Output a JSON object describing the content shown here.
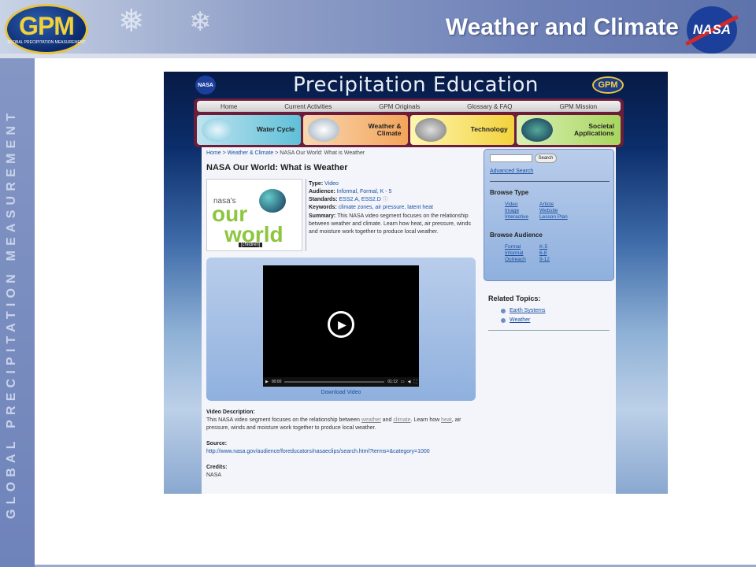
{
  "slide": {
    "title": "Weather and Climate",
    "logo_left": "GPM",
    "logo_left_sub": "GLOBAL PRECIPITATION MEASUREMENT",
    "logo_right": "NASA",
    "vertical_text": "GLOBAL PRECIPITATION MEASUREMENT"
  },
  "site": {
    "title": "Precipitation Education",
    "nasa_badge": "NASA",
    "gpm_badge": "GPM",
    "nav": [
      "Home",
      "Current Activities",
      "GPM Originals",
      "Glossary & FAQ",
      "GPM Mission"
    ],
    "categories": [
      {
        "label": "Water Cycle"
      },
      {
        "label": "Weather & Climate"
      },
      {
        "label": "Technology"
      },
      {
        "label": "Societal Applications"
      }
    ]
  },
  "page": {
    "breadcrumb": {
      "home": "Home",
      "sep1": " > ",
      "section": "Weather & Climate",
      "sep2": " > ",
      "current": "NASA Our World: What is Weather"
    },
    "title": "NASA Our World: What is Weather",
    "thumb": {
      "line1": "nasa's",
      "line2": "our",
      "line3": "world",
      "tag": "[children]"
    },
    "meta": {
      "type_label": "Type:",
      "type_value": "Video",
      "audience_label": "Audience:",
      "audience_value": "Informal, Formal, K - 5",
      "standards_label": "Standards:",
      "standards_value": "ESS2.A, ESS2.D",
      "keywords_label": "Keywords:",
      "keywords_value": "climate zones, air pressure, latent heat",
      "summary_label": "Summary:",
      "summary_value": "This NASA video segment focuses on the relationship between weather and climate. Learn how heat, air pressure, winds and moisture work together to produce local weather."
    },
    "player": {
      "time_current": "00:00",
      "time_total": "01:12",
      "download": "Download Video"
    },
    "description": {
      "label": "Video Description:",
      "text1": "This NASA video segment focuses on the relationship between ",
      "link1": "weather",
      "text2": " and ",
      "link2": "climate",
      "text3": ". Learn how ",
      "link3": "heat",
      "text4": ", air pressure, winds and moisture work together to produce local weather."
    },
    "source": {
      "label": "Source:",
      "url": "http://www.nasa.gov/audience/foreducators/nasaeclips/search.html?terms=&category=1000"
    },
    "credits": {
      "label": "Credits:",
      "value": "NASA"
    }
  },
  "sidebar": {
    "search_button": "Search",
    "advanced": "Advanced Search",
    "browse_type_title": "Browse Type",
    "browse_type": [
      "Video",
      "Article",
      "Image",
      "Website",
      "Interactive",
      "Lesson Plan"
    ],
    "browse_audience_title": "Browse Audience",
    "browse_audience": [
      "Formal",
      "K-5",
      "Informal",
      "6-8",
      "Outreach",
      "9-12"
    ],
    "related_title": "Related Topics:",
    "related": [
      "Earth Systems",
      "Weather"
    ]
  }
}
